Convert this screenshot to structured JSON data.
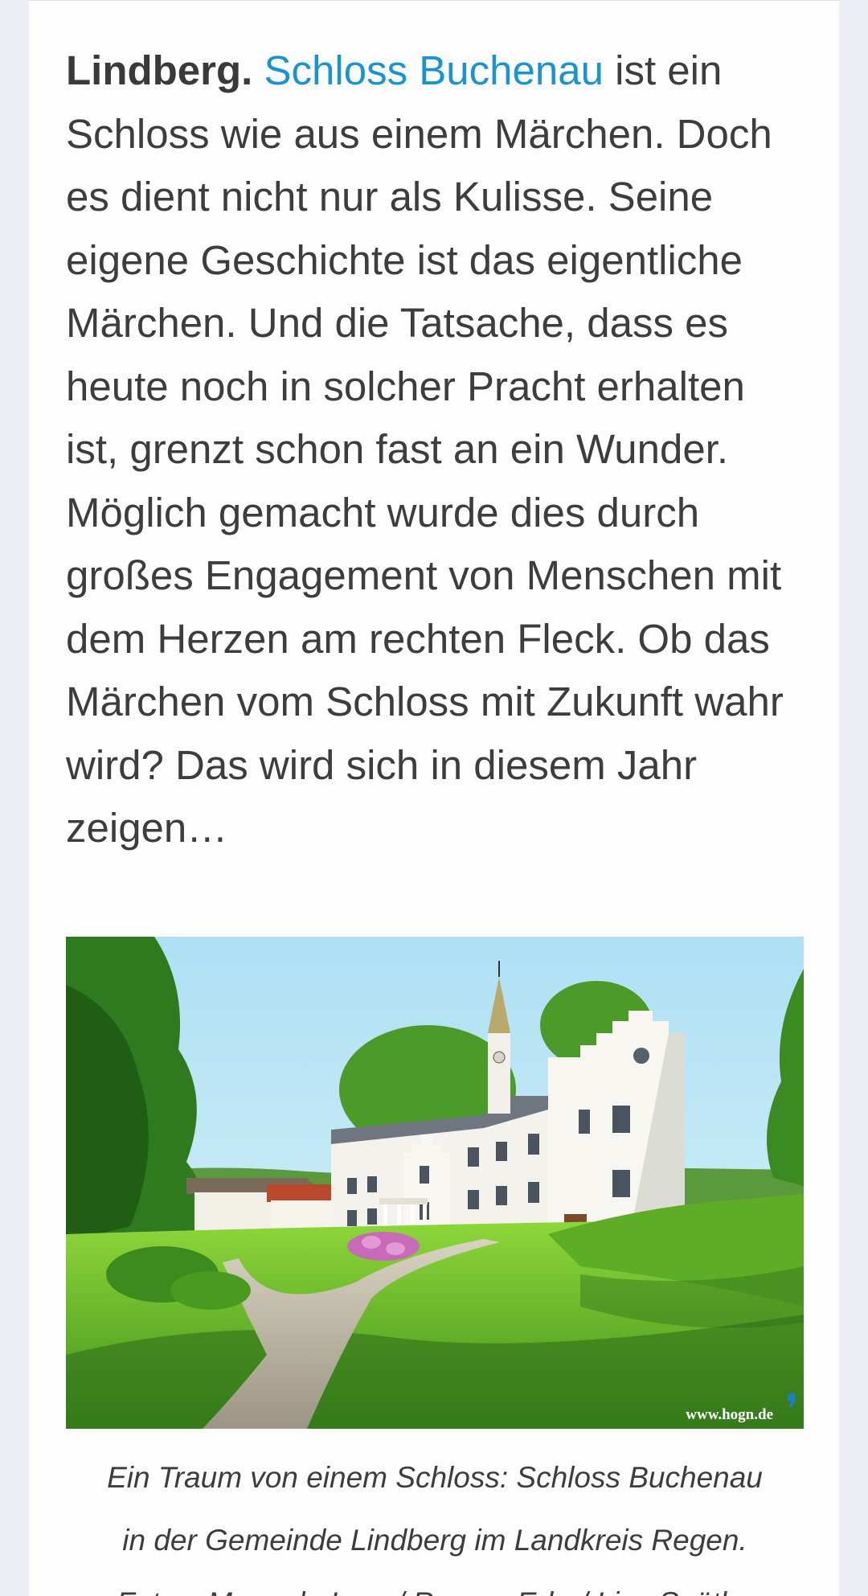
{
  "article": {
    "dateline": "Lindberg.",
    "link_text": "Schloss Buchenau",
    "body_text": " ist ein Schloss wie aus einem Märchen. Doch es dient nicht nur als Kulisse. Seine eigene Geschichte ist das eigentliche Märchen. Und die Tatsache, dass es heute noch in solcher Pracht erhalten ist, grenzt schon fast an ein Wunder. Möglich gemacht wurde dies durch großes Engagement von Menschen mit dem Herzen am rechten Fleck. Ob das Märchen vom Schloss mit Zukunft wahr wird? Das wird sich in diesem Jahr zeigen…"
  },
  "figure": {
    "watermark": "www.hogn.de",
    "watermark_mark": "❜",
    "caption_lines": [
      "Ein Traum von einem Schloss: Schloss Buchenau",
      "in der Gemeinde Lindberg im Landkreis Regen.",
      "Fotos: Manuela Lang/ Roman Eder/ Lisa Spöthe"
    ]
  },
  "colors": {
    "link": "#1a93d1",
    "text": "#3d3d3d",
    "page_background": "#eceef4",
    "card_background": "#fdfdfe",
    "watermark_mark": "#1e7fc4"
  }
}
